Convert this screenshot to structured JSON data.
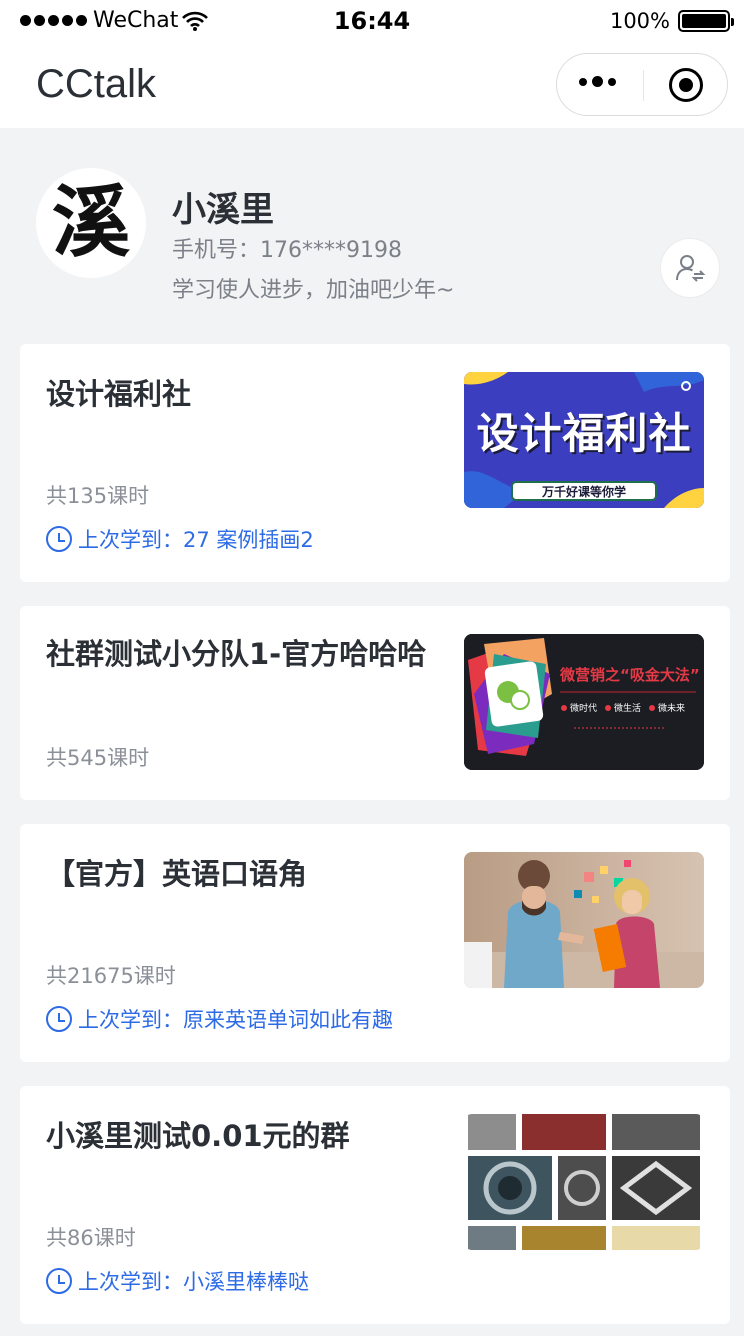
{
  "status_bar": {
    "carrier": "WeChat",
    "time": "16:44",
    "battery": "100%",
    "battery_level": 1.0
  },
  "nav": {
    "title": "CCtalk"
  },
  "profile": {
    "avatar_char": "溪",
    "name": "小溪里",
    "phone": "手机号：176****9198",
    "motto": "学习使人进步，加油吧少年~"
  },
  "courses": [
    {
      "title": "设计福利社",
      "count": "共135课时",
      "last_learned": "上次学到：27 案例插画2",
      "thumb": {
        "headline": "设计福利社",
        "tagline": "万千好课等你学"
      }
    },
    {
      "title": "社群测试小分队1-官方哈哈哈",
      "count": "共545课时",
      "thumb": {
        "headline": "微营销之“吸金大法”",
        "items": [
          "微时代",
          "微生活",
          "微未来"
        ]
      }
    },
    {
      "title": "【官方】英语口语角",
      "count": "共21675课时",
      "last_learned": "上次学到：原来英语单词如此有趣"
    },
    {
      "title": "小溪里测试0.01元的群",
      "count": "共86课时",
      "last_learned": "上次学到：小溪里棒棒哒"
    }
  ],
  "colors": {
    "accent": "#2d6be6",
    "background": "#f2f3f5",
    "card": "#ffffff",
    "title_text": "#2b2f36",
    "secondary_text": "#8b9098"
  }
}
